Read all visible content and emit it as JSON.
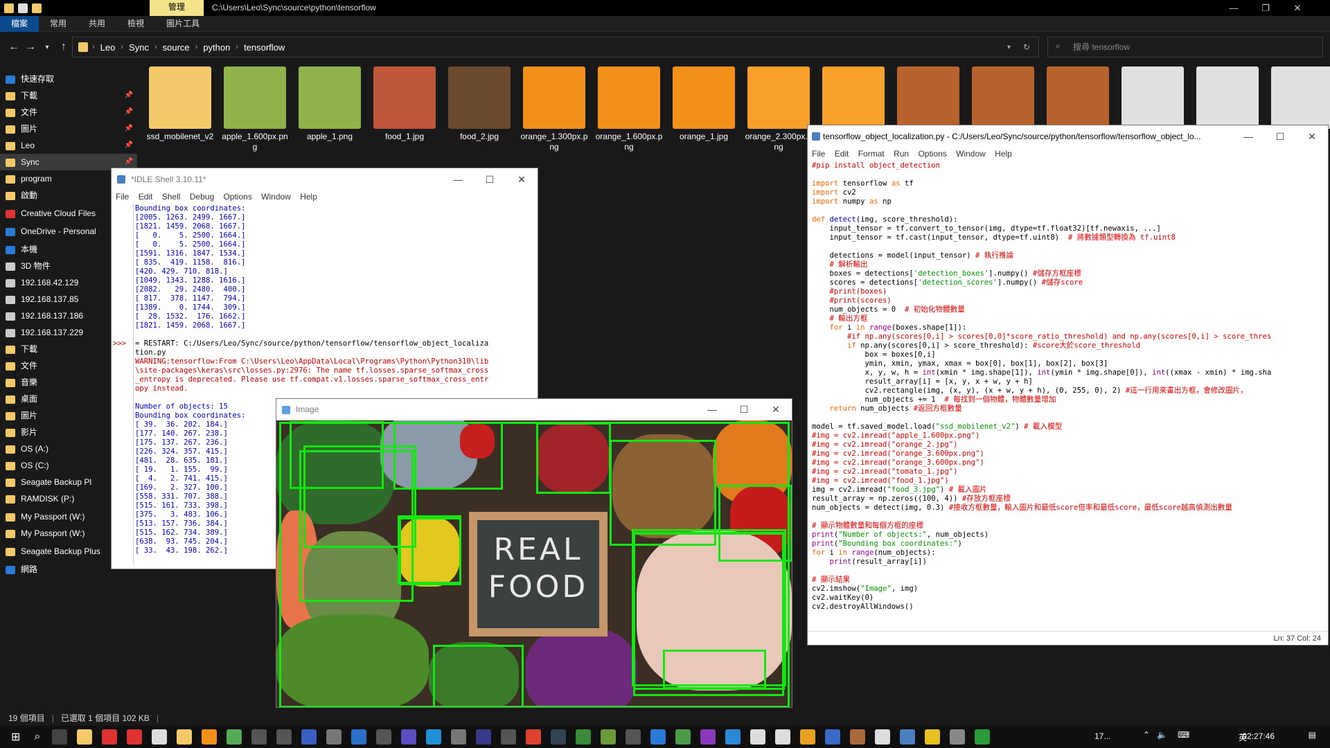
{
  "titlebar": {
    "manage": "管理",
    "path": "C:\\Users\\Leo\\Sync\\source\\python\\tensorflow"
  },
  "ribbon": {
    "tabs": [
      "檔案",
      "常用",
      "共用",
      "檢視",
      "圖片工具"
    ]
  },
  "address": {
    "crumbs": [
      "Leo",
      "Sync",
      "source",
      "python",
      "tensorflow"
    ],
    "search_placeholder": "搜尋 tensorflow"
  },
  "nav": {
    "items": [
      {
        "label": "快速存取",
        "pinned": false
      },
      {
        "label": "下載",
        "pinned": true
      },
      {
        "label": "文件",
        "pinned": true
      },
      {
        "label": "圖片",
        "pinned": true
      },
      {
        "label": "Leo",
        "pinned": true
      },
      {
        "label": "Sync",
        "pinned": true
      },
      {
        "label": "program",
        "pinned": false
      },
      {
        "label": "啟動",
        "pinned": false
      },
      {
        "label": "Creative Cloud Files",
        "pinned": false
      },
      {
        "label": "OneDrive - Personal",
        "pinned": false
      },
      {
        "label": "本機",
        "pinned": false
      },
      {
        "label": "3D 物件",
        "pinned": false
      },
      {
        "label": "192.168.42.129",
        "pinned": false
      },
      {
        "label": "192.168.137.85",
        "pinned": false
      },
      {
        "label": "192.168.137.186",
        "pinned": false
      },
      {
        "label": "192.168.137.229",
        "pinned": false
      },
      {
        "label": "下載",
        "pinned": false
      },
      {
        "label": "文件",
        "pinned": false
      },
      {
        "label": "音樂",
        "pinned": false
      },
      {
        "label": "桌面",
        "pinned": false
      },
      {
        "label": "圖片",
        "pinned": false
      },
      {
        "label": "影片",
        "pinned": false
      },
      {
        "label": "OS (A:)",
        "pinned": false
      },
      {
        "label": "OS (C:)",
        "pinned": false
      },
      {
        "label": "Seagate Backup Pl",
        "pinned": false
      },
      {
        "label": "RAMDISK (P:)",
        "pinned": false
      },
      {
        "label": "My Passport (W:)",
        "pinned": false
      },
      {
        "label": "My Passport (W:)",
        "pinned": false
      },
      {
        "label": "Seagate Backup Plus",
        "pinned": false
      },
      {
        "label": "網路",
        "pinned": false
      }
    ]
  },
  "files": [
    {
      "name": "ssd_mobilenet_v2",
      "color": "#f3c969"
    },
    {
      "name": "apple_1.600px.png",
      "color": "#8fb34a"
    },
    {
      "name": "apple_1.png",
      "color": "#8fb34a"
    },
    {
      "name": "food_1.jpg",
      "color": "#c0573b"
    },
    {
      "name": "food_2.jpg",
      "color": "#6b4a2e"
    },
    {
      "name": "orange_1.300px.png",
      "color": "#f39018"
    },
    {
      "name": "orange_1.600px.png",
      "color": "#f39018"
    },
    {
      "name": "orange_1.jpg",
      "color": "#f39018"
    },
    {
      "name": "orange_2.300px.png",
      "color": "#f7a12a"
    },
    {
      "name": "",
      "color": "#f7a12a"
    },
    {
      "name": "",
      "color": "#b8622e"
    },
    {
      "name": "",
      "color": "#b8622e"
    },
    {
      "name": "",
      "color": "#b8622e"
    },
    {
      "name": "",
      "color": "#e0e0e0"
    },
    {
      "name": "",
      "color": "#e0e0e0"
    },
    {
      "name": "",
      "color": "#e0e0e0"
    }
  ],
  "status": {
    "count": "19 個項目",
    "selected": "已選取 1 個項目 102 KB"
  },
  "idle": {
    "title": "*IDLE Shell 3.10.11*",
    "menu": [
      "File",
      "Edit",
      "Shell",
      "Debug",
      "Options",
      "Window",
      "Help"
    ],
    "output": "Bounding box coordinates:\n[2005. 1263. 2499. 1667.]\n[1821. 1459. 2068. 1667.]\n[   0.    5. 2500. 1664.]\n[   0.    5. 2500. 1664.]\n[1591. 1316. 1847. 1534.]\n[ 835.  419. 1158.  816.]\n[420. 429. 710. 818.]\n[1049. 1343. 1288. 1616.]\n[2082.   29. 2480.  400.]\n[ 817.  378. 1147.  794.]\n[1389.    0. 1744.  309.]\n[  28. 1532.  176. 1662.]\n[1821. 1459. 2068. 1667.]",
    "prompt": ">>>",
    "restart": "= RESTART: C:/Users/Leo/Sync/source/python/tensorflow/tensorflow_object_localiza\ntion.py",
    "warning": "WARNING:tensorflow:From C:\\Users\\Leo\\AppData\\Local\\Programs\\Python\\Python310\\lib\n\\site-packages\\keras\\src\\losses.py:2976: The name tf.losses.sparse_softmax_cross\n_entropy is deprecated. Please use tf.compat.v1.losses.sparse_softmax_cross_entr\nopy instead.",
    "output2": "Number of objects: 15\nBounding box coordinates:\n[ 39.  36. 202. 184.]\n[177. 140. 267. 238.]\n[175. 137. 267. 236.]\n[226. 324. 357. 415.]\n[481.  28. 635. 181.]\n[ 19.   1. 155.  99.]\n[  4.   2. 741. 415.]\n[169.   2. 327. 100.]\n[558. 331. 707. 388.]\n[515. 161. 733. 398.]\n[375.   3. 483. 106.]\n[513. 157. 736. 384.]\n[515. 162. 734. 389.]\n[638.  93. 745. 204.]\n[ 33.  43. 198. 262.]"
  },
  "editor": {
    "title": "tensorflow_object_localization.py - C:/Users/Leo/Sync/source/python/tensorflow/tensorflow_object_lo...",
    "menu": [
      "File",
      "Edit",
      "Format",
      "Run",
      "Options",
      "Window",
      "Help"
    ],
    "status": "Ln: 37    Col: 24"
  },
  "imgwin": {
    "title": "Image",
    "sign": "REAL\nFOOD"
  },
  "taskbar": {
    "time": "02:27:46",
    "weather": "17...",
    "ime": "英"
  }
}
